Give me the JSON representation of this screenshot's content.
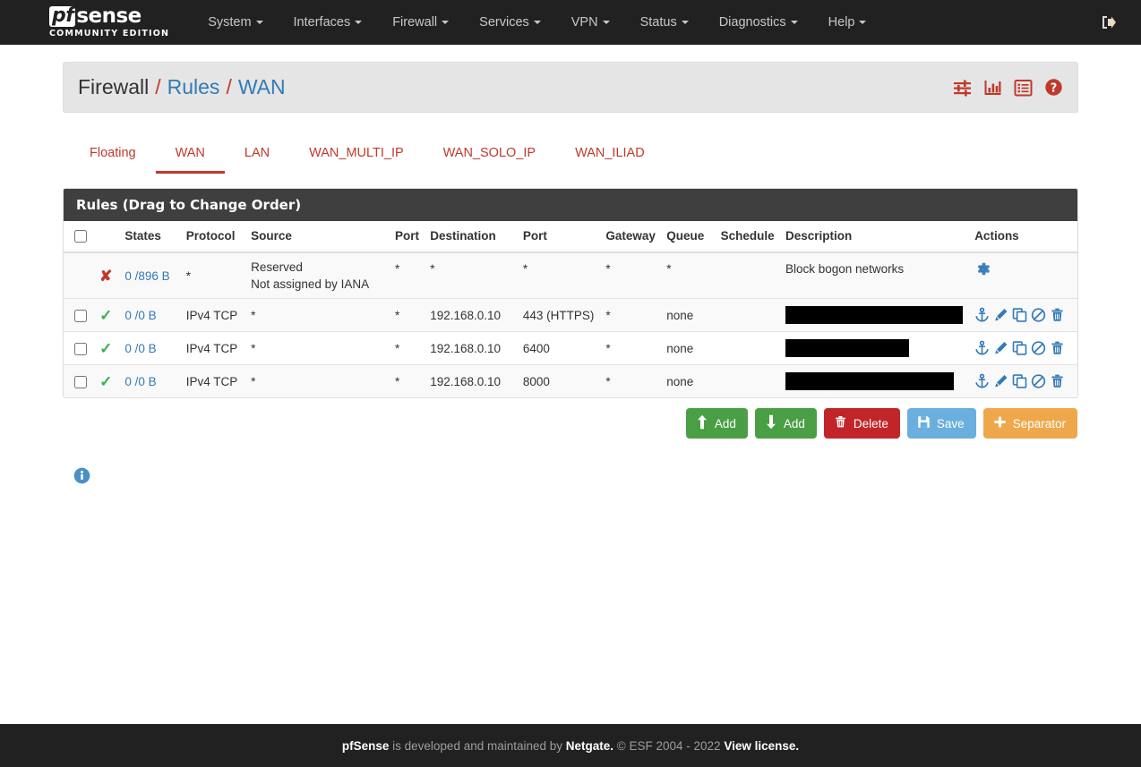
{
  "navbar": {
    "brand": {
      "pf": "pf",
      "sense": "sense",
      "subtitle": "COMMUNITY EDITION"
    },
    "items": [
      {
        "label": "System",
        "caret": true
      },
      {
        "label": "Interfaces",
        "caret": true
      },
      {
        "label": "Firewall",
        "caret": true
      },
      {
        "label": "Services",
        "caret": true
      },
      {
        "label": "VPN",
        "caret": true
      },
      {
        "label": "Status",
        "caret": true
      },
      {
        "label": "Diagnostics",
        "caret": true
      },
      {
        "label": "Help",
        "caret": true
      }
    ],
    "logout_icon": "logout-icon"
  },
  "breadcrumb": {
    "root": "Firewall",
    "sep": "/",
    "section": "Rules",
    "page": "WAN"
  },
  "header_icons": [
    {
      "name": "sliders-icon"
    },
    {
      "name": "bar-chart-icon"
    },
    {
      "name": "list-icon"
    },
    {
      "name": "help-icon"
    }
  ],
  "tabs": [
    {
      "label": "Floating",
      "active": false
    },
    {
      "label": "WAN",
      "active": true
    },
    {
      "label": "LAN",
      "active": false
    },
    {
      "label": "WAN_MULTI_IP",
      "active": false
    },
    {
      "label": "WAN_SOLO_IP",
      "active": false
    },
    {
      "label": "WAN_ILIAD",
      "active": false
    }
  ],
  "panel": {
    "title": "Rules (Drag to Change Order)"
  },
  "table": {
    "headers": {
      "checkbox": "",
      "state": "",
      "states": "States",
      "protocol": "Protocol",
      "source": "Source",
      "port_src": "Port",
      "destination": "Destination",
      "port_dst": "Port",
      "gateway": "Gateway",
      "queue": "Queue",
      "schedule": "Schedule",
      "description": "Description",
      "actions": "Actions"
    },
    "rows": [
      {
        "checkbox": false,
        "has_checkbox": false,
        "state_icon": "block-x-icon",
        "states": "0 /896 B",
        "protocol": "*",
        "source_line1": "Reserved",
        "source_line2": "Not assigned by IANA",
        "port_src": "*",
        "destination": "*",
        "port_dst": "*",
        "gateway": "*",
        "queue": "*",
        "schedule": "",
        "description": "Block bogon networks",
        "description_redacted": false,
        "actions": [
          "gear-icon"
        ],
        "stripe": true
      },
      {
        "checkbox": false,
        "has_checkbox": true,
        "state_icon": "pass-check-icon",
        "states": "0 /0 B",
        "protocol": "IPv4 TCP",
        "source_line1": "*",
        "source_line2": "",
        "port_src": "*",
        "destination": "192.168.0.10",
        "port_dst": "443 (HTTPS)",
        "gateway": "*",
        "queue": "none",
        "schedule": "",
        "description": "",
        "description_redacted": true,
        "redaction_width": 198,
        "actions": [
          "anchor-icon",
          "pencil-icon",
          "copy-icon",
          "ban-icon",
          "trash-icon"
        ],
        "stripe": true
      },
      {
        "checkbox": false,
        "has_checkbox": true,
        "state_icon": "pass-check-icon",
        "states": "0 /0 B",
        "protocol": "IPv4 TCP",
        "source_line1": "*",
        "source_line2": "",
        "port_src": "*",
        "destination": "192.168.0.10",
        "port_dst": "6400",
        "gateway": "*",
        "queue": "none",
        "schedule": "",
        "description": "",
        "description_redacted": true,
        "redaction_width": 138,
        "actions": [
          "anchor-icon",
          "pencil-icon",
          "copy-icon",
          "ban-icon",
          "trash-icon"
        ],
        "stripe": false
      },
      {
        "checkbox": false,
        "has_checkbox": true,
        "state_icon": "pass-check-icon",
        "states": "0 /0 B",
        "protocol": "IPv4 TCP",
        "source_line1": "*",
        "source_line2": "",
        "port_src": "*",
        "destination": "192.168.0.10",
        "port_dst": "8000",
        "gateway": "*",
        "queue": "none",
        "schedule": "",
        "description": "",
        "description_redacted": true,
        "redaction_width": 188,
        "actions": [
          "anchor-icon",
          "pencil-icon",
          "copy-icon",
          "ban-icon",
          "trash-icon"
        ],
        "stripe": true
      }
    ]
  },
  "buttons": [
    {
      "label": "Add",
      "icon": "arrow-up-icon",
      "style": "btn-success"
    },
    {
      "label": "Add",
      "icon": "arrow-down-icon",
      "style": "btn-success"
    },
    {
      "label": "Delete",
      "icon": "trash-icon",
      "style": "btn-danger"
    },
    {
      "label": "Save",
      "icon": "save-icon",
      "style": "btn-info"
    },
    {
      "label": "Separator",
      "icon": "plus-icon",
      "style": "btn-warning"
    }
  ],
  "info_note": {
    "icon": "info-icon"
  },
  "footer": {
    "brand": "pfSense",
    "text1": " is developed and maintained by ",
    "company": "Netgate.",
    "copyright": " © ESF 2004 - 2022 ",
    "license_link": "View license."
  },
  "colors": {
    "navbar_bg": "#212121",
    "accent_red": "#c0392b",
    "link_blue": "#337ab7",
    "pass_green": "#3ab24a",
    "panel_header": "#3f3f3f",
    "icon_blue": "#337ab7",
    "btn_success": "#4a9f45",
    "btn_danger": "#c1252a",
    "btn_info": "#6aafdd",
    "btn_warning": "#eea84b"
  }
}
